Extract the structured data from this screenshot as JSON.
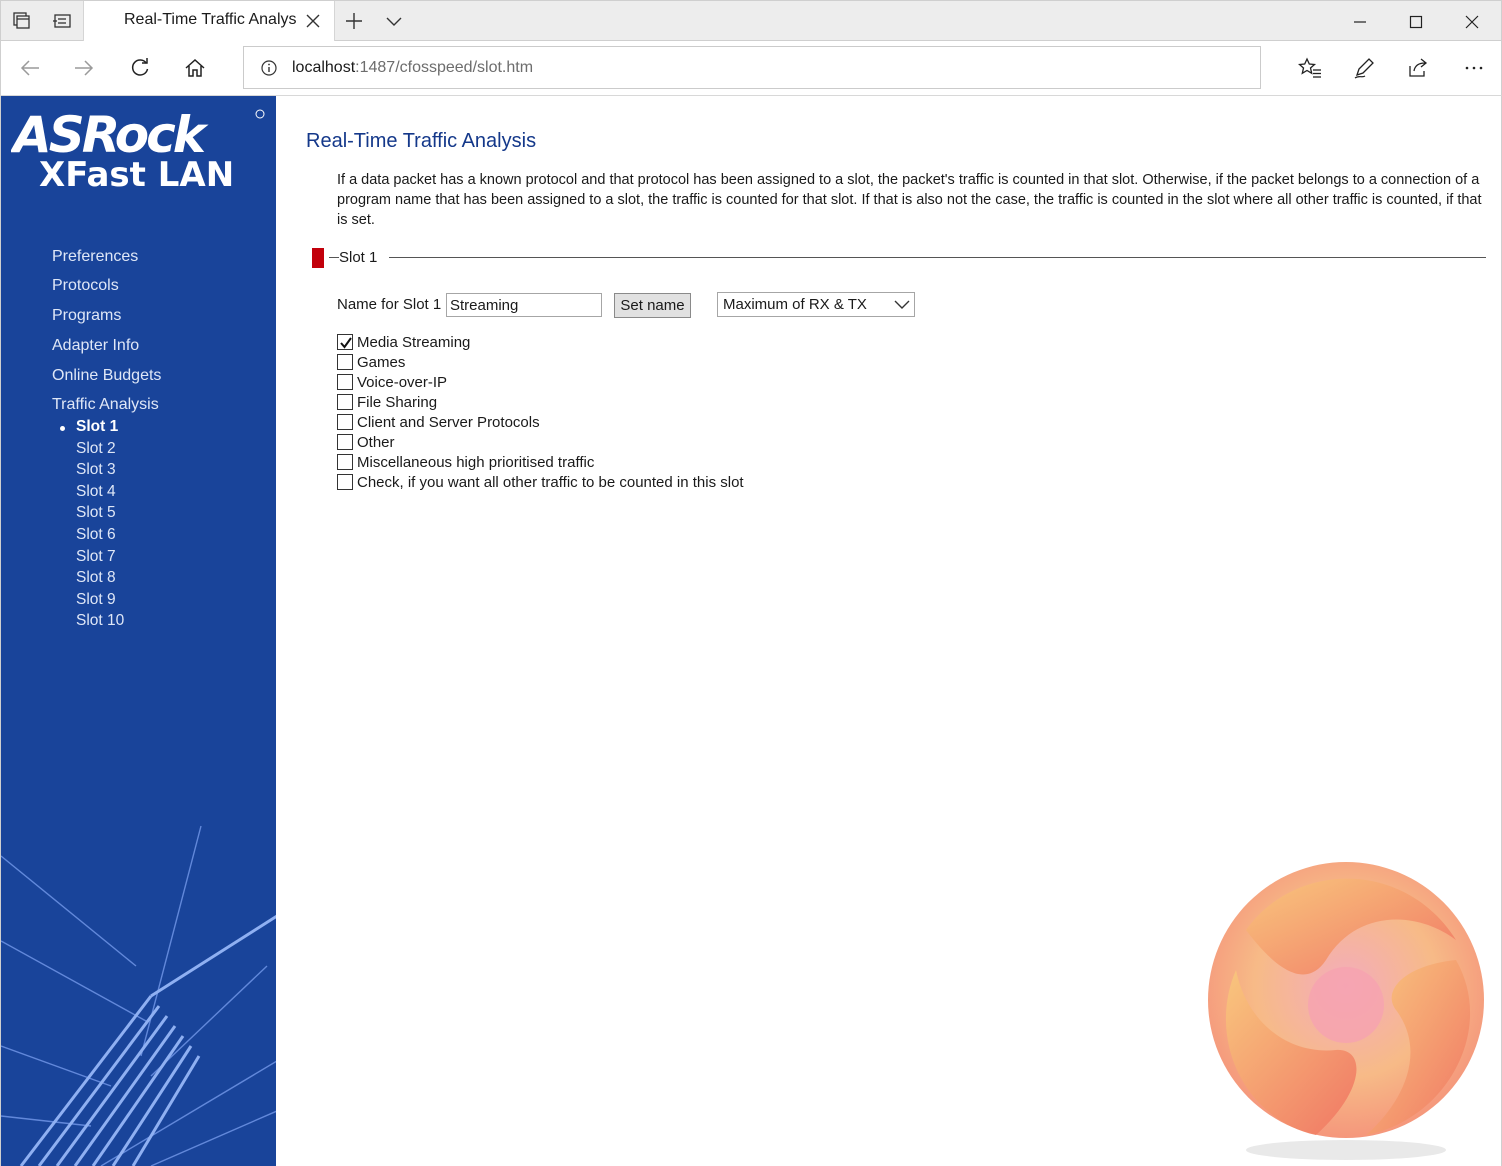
{
  "browser": {
    "tab_title": "Real-Time Traffic Analys",
    "url_host": "localhost",
    "url_rest": ":1487/cfosspeed/slot.htm"
  },
  "sidebar": {
    "logo_brand": "ASRock",
    "logo_product": "XFast LAN",
    "menu": [
      "Preferences",
      "Protocols",
      "Programs",
      "Adapter Info",
      "Online Budgets",
      "Traffic Analysis"
    ],
    "slots": [
      "Slot 1",
      "Slot 2",
      "Slot 3",
      "Slot 4",
      "Slot 5",
      "Slot 6",
      "Slot 7",
      "Slot 8",
      "Slot 9",
      "Slot 10"
    ],
    "active_slot": "Slot 1"
  },
  "main": {
    "title": "Real-Time Traffic Analysis",
    "description": "If a data packet has a known protocol and that protocol has been assigned to a slot, the packet's traffic is counted in that slot. Otherwise, if the packet belongs to a connection of a program name that has been assigned to a slot, the traffic is counted for that slot. If that is also not the case, the traffic is counted in the slot where all other traffic is counted, if that is set.",
    "slot_legend": "Slot 1",
    "name_label": "Name for Slot 1",
    "name_value": "Streaming",
    "set_name_label": "Set name",
    "mode_selected": "Maximum of RX & TX",
    "checkboxes": [
      {
        "label": "Media Streaming",
        "checked": true
      },
      {
        "label": "Games",
        "checked": false
      },
      {
        "label": "Voice-over-IP",
        "checked": false
      },
      {
        "label": "File Sharing",
        "checked": false
      },
      {
        "label": "Client and Server Protocols",
        "checked": false
      },
      {
        "label": "Other",
        "checked": false
      },
      {
        "label": "Miscellaneous high prioritised traffic",
        "checked": false
      },
      {
        "label": "Check, if you want all other traffic to be counted in this slot",
        "checked": false
      }
    ]
  },
  "colors": {
    "sidebar_bg": "#19449a",
    "title_blue": "#14388a",
    "slot_marker": "#c2000b"
  }
}
